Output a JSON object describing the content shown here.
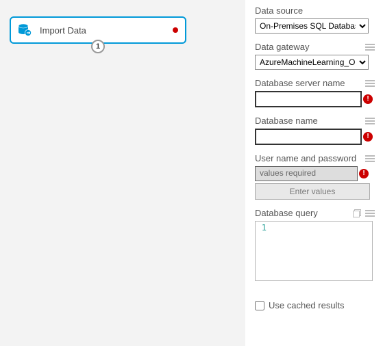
{
  "module": {
    "title": "Import Data",
    "port_number": "1"
  },
  "props": {
    "data_source": {
      "label": "Data source",
      "value": "On-Premises SQL Database"
    },
    "data_gateway": {
      "label": "Data gateway",
      "value": "AzureMachineLearning_On"
    },
    "server_name": {
      "label": "Database server name",
      "value": ""
    },
    "db_name": {
      "label": "Database name",
      "value": ""
    },
    "credentials": {
      "label": "User name and password",
      "status": "values required",
      "button": "Enter values"
    },
    "query": {
      "label": "Database query",
      "line_number": "1",
      "value": ""
    },
    "cached": {
      "label": "Use cached results",
      "checked": false
    }
  }
}
